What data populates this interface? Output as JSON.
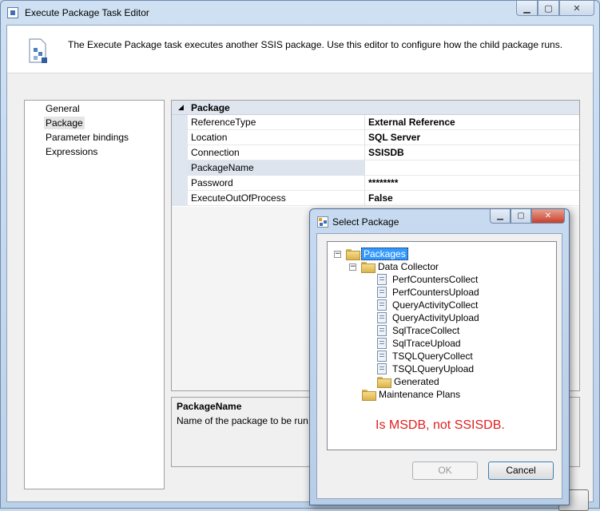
{
  "window": {
    "title": "Execute Package Task Editor",
    "description": "The Execute Package task executes another SSIS package. Use this editor to configure how the child package runs."
  },
  "nav": {
    "items": [
      "General",
      "Package",
      "Parameter bindings",
      "Expressions"
    ],
    "selected": "Package"
  },
  "grid": {
    "category": "Package",
    "rows": [
      {
        "name": "ReferenceType",
        "value": "External Reference"
      },
      {
        "name": "Location",
        "value": "SQL Server"
      },
      {
        "name": "Connection",
        "value": "SSISDB"
      },
      {
        "name": "PackageName",
        "value": ""
      },
      {
        "name": "Password",
        "value": "********"
      },
      {
        "name": "ExecuteOutOfProcess",
        "value": "False"
      }
    ]
  },
  "help": {
    "title": "PackageName",
    "body": "Name of the package to be run,"
  },
  "dialog": {
    "title": "Select Package",
    "tree": {
      "root": "Packages",
      "data_collector": "Data Collector",
      "packages": [
        "PerfCountersCollect",
        "PerfCountersUpload",
        "QueryActivityCollect",
        "QueryActivityUpload",
        "SqlTraceCollect",
        "SqlTraceUpload",
        "TSQLQueryCollect",
        "TSQLQueryUpload"
      ],
      "generated": "Generated",
      "maintenance": "Maintenance Plans"
    },
    "annotation": "Is MSDB, not SSISDB.",
    "ok_label": "OK",
    "cancel_label": "Cancel"
  }
}
